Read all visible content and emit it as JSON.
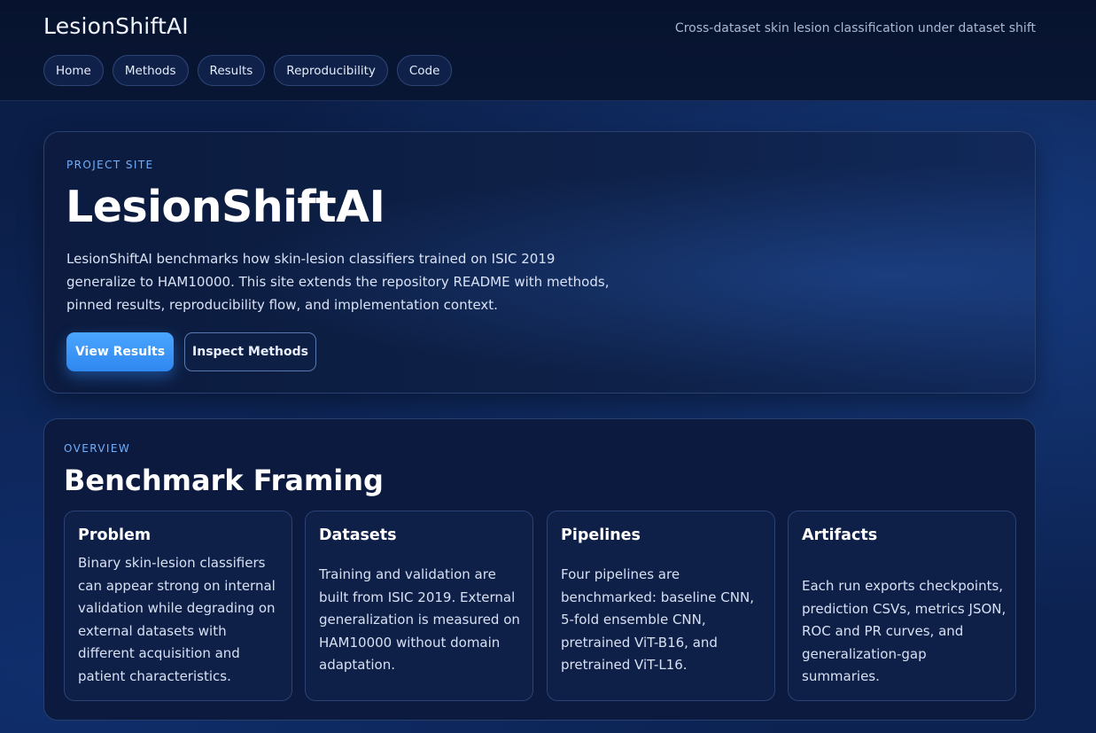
{
  "header": {
    "brand": "LesionShiftAI",
    "tagline": "Cross-dataset skin lesion classification under dataset shift",
    "nav": [
      "Home",
      "Methods",
      "Results",
      "Reproducibility",
      "Code"
    ]
  },
  "hero": {
    "eyebrow": "PROJECT SITE",
    "title": "LesionShiftAI",
    "description": "LesionShiftAI benchmarks how skin-lesion classifiers trained on ISIC 2019 generalize to HAM10000. This site extends the repository README with methods, pinned results, reproducibility flow, and implementation context.",
    "primary_button": "View Results",
    "secondary_button": "Inspect Methods"
  },
  "overview": {
    "eyebrow": "OVERVIEW",
    "title": "Benchmark Framing",
    "cards": [
      {
        "title": "Problem",
        "body": "Binary skin-lesion classifiers can appear strong on internal validation while degrading on external datasets with different acquisition and patient characteristics."
      },
      {
        "title": "Datasets",
        "body": "Training and validation are built from ISIC 2019. External generalization is measured on HAM10000 without domain adaptation."
      },
      {
        "title": "Pipelines",
        "body": "Four pipelines are benchmarked: baseline CNN, 5-fold ensemble CNN, pretrained ViT-B16, and pretrained ViT-L16."
      },
      {
        "title": "Artifacts",
        "body": "Each run exports checkpoints, prediction CSVs, metrics JSON, ROC and PR curves, and generalization-gap summaries."
      }
    ]
  },
  "colors": {
    "accent": "#3b95f8",
    "eyebrow": "#6fb0ff",
    "background": "#0b1d45"
  }
}
